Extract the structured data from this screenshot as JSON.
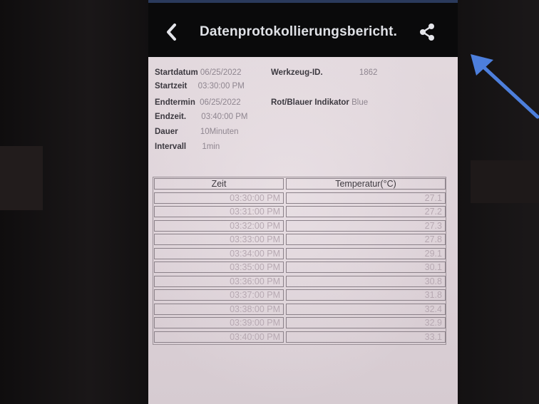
{
  "app_bar": {
    "title": "Datenprotokollierungsbericht.",
    "back_icon": "chevron-left-icon",
    "share_icon": "share-icon"
  },
  "report_info": {
    "start_date_label": "Startdatum",
    "start_date": "06/25/2022",
    "start_time_label": "Startzeit",
    "start_time": "03:30:00 PM",
    "end_date_label": "Endtermin",
    "end_date": "06/25/2022",
    "end_time_label": "Endzeit.",
    "end_time": "03:40:00 PM",
    "duration_label": "Dauer",
    "duration": "10Minuten",
    "interval_label": "Intervall",
    "interval": "1min",
    "tool_id_label": "Werkzeug-ID.",
    "tool_id": "1862",
    "indicator_label": "Rot/Blauer Indikator",
    "indicator": "Blue"
  },
  "table": {
    "headers": [
      "Zeit",
      "Temperatur(°C)"
    ],
    "rows": [
      [
        "03:30:00 PM",
        "27.1"
      ],
      [
        "03:31:00 PM",
        "27.2"
      ],
      [
        "03:32:00 PM",
        "27.3"
      ],
      [
        "03:33:00 PM",
        "27.8"
      ],
      [
        "03:34:00 PM",
        "29.1"
      ],
      [
        "03:35:00 PM",
        "30.1"
      ],
      [
        "03:36:00 PM",
        "30.8"
      ],
      [
        "03:37:00 PM",
        "31.8"
      ],
      [
        "03:38:00 PM",
        "32.4"
      ],
      [
        "03:39:00 PM",
        "32.9"
      ],
      [
        "03:40:00 PM",
        "33.1"
      ]
    ]
  },
  "colors": {
    "annotation_arrow": "#4d7fdc",
    "report_background": "#e2d8dd"
  }
}
